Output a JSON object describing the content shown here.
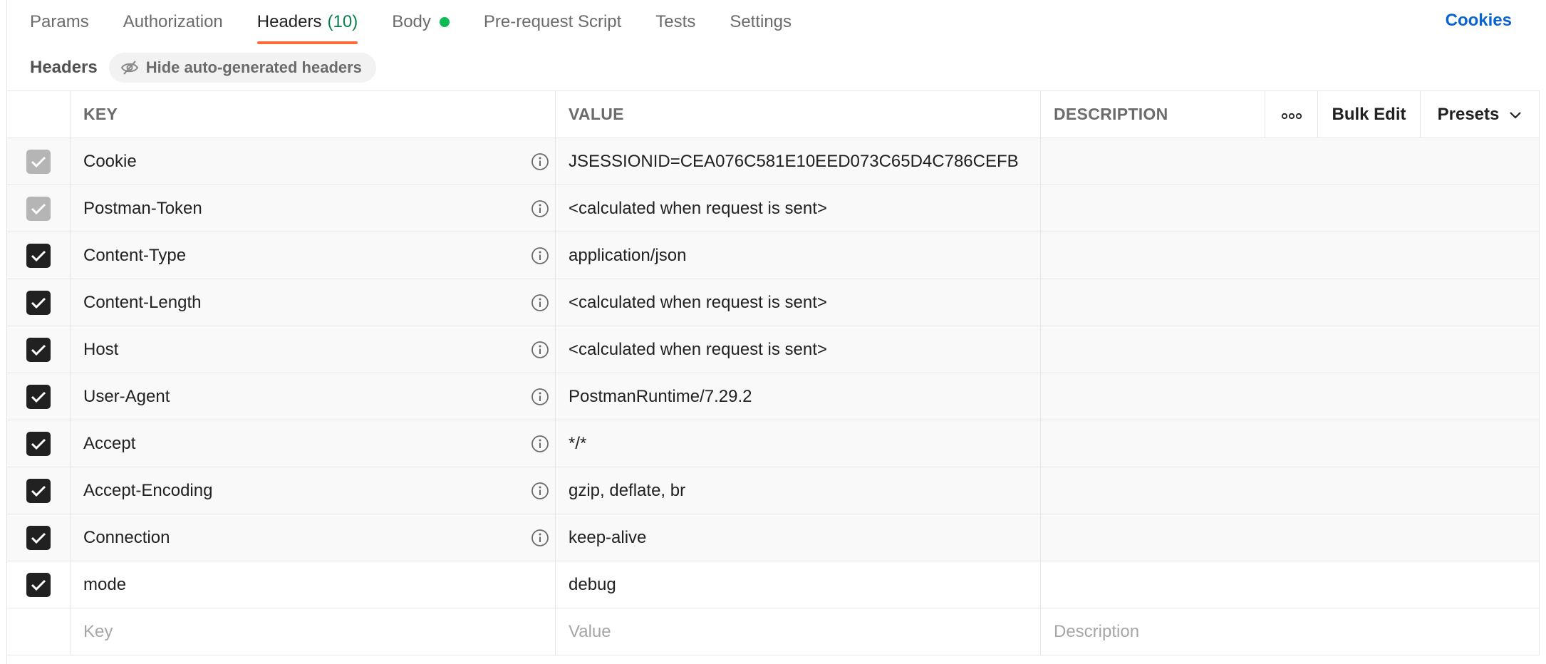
{
  "tabs": [
    {
      "label": "Params"
    },
    {
      "label": "Authorization"
    },
    {
      "label": "Headers",
      "count": "(10)"
    },
    {
      "label": "Body"
    },
    {
      "label": "Pre-request Script"
    },
    {
      "label": "Tests"
    },
    {
      "label": "Settings"
    }
  ],
  "cookies_label": "Cookies",
  "subheader": {
    "title": "Headers",
    "hide_button": "Hide auto-generated headers"
  },
  "table": {
    "columns": {
      "key": "KEY",
      "value": "VALUE",
      "description": "DESCRIPTION",
      "bulk_edit": "Bulk Edit",
      "presets": "Presets"
    },
    "rows": [
      {
        "key": "Cookie",
        "value": "JSESSIONID=CEA076C581E10EED073C65D4C786CEFB",
        "checked": true,
        "auto": true
      },
      {
        "key": "Postman-Token",
        "value": "<calculated when request is sent>",
        "checked": true,
        "auto": true
      },
      {
        "key": "Content-Type",
        "value": "application/json",
        "checked": true,
        "auto": false
      },
      {
        "key": "Content-Length",
        "value": "<calculated when request is sent>",
        "checked": true,
        "auto": false
      },
      {
        "key": "Host",
        "value": "<calculated when request is sent>",
        "checked": true,
        "auto": false
      },
      {
        "key": "User-Agent",
        "value": "PostmanRuntime/7.29.2",
        "checked": true,
        "auto": false
      },
      {
        "key": "Accept",
        "value": "*/*",
        "checked": true,
        "auto": false
      },
      {
        "key": "Accept-Encoding",
        "value": "gzip, deflate, br",
        "checked": true,
        "auto": false
      },
      {
        "key": "Connection",
        "value": "keep-alive",
        "checked": true,
        "auto": false
      },
      {
        "key": "mode",
        "value": "debug",
        "checked": true,
        "auto": false
      }
    ],
    "new_row": {
      "key_placeholder": "Key",
      "value_placeholder": "Value",
      "description_placeholder": "Description"
    }
  },
  "colors": {
    "active_tab_underline": "#ff6c37",
    "count_green": "#0a7f4b",
    "body_dot": "#0cbb52",
    "link_blue": "#0b63d1"
  },
  "icons": {
    "info": "info-circle-icon",
    "check": "check-icon",
    "eye_off": "eye-slash-icon",
    "more": "ellipsis-icon",
    "chevron": "chevron-down-icon"
  }
}
